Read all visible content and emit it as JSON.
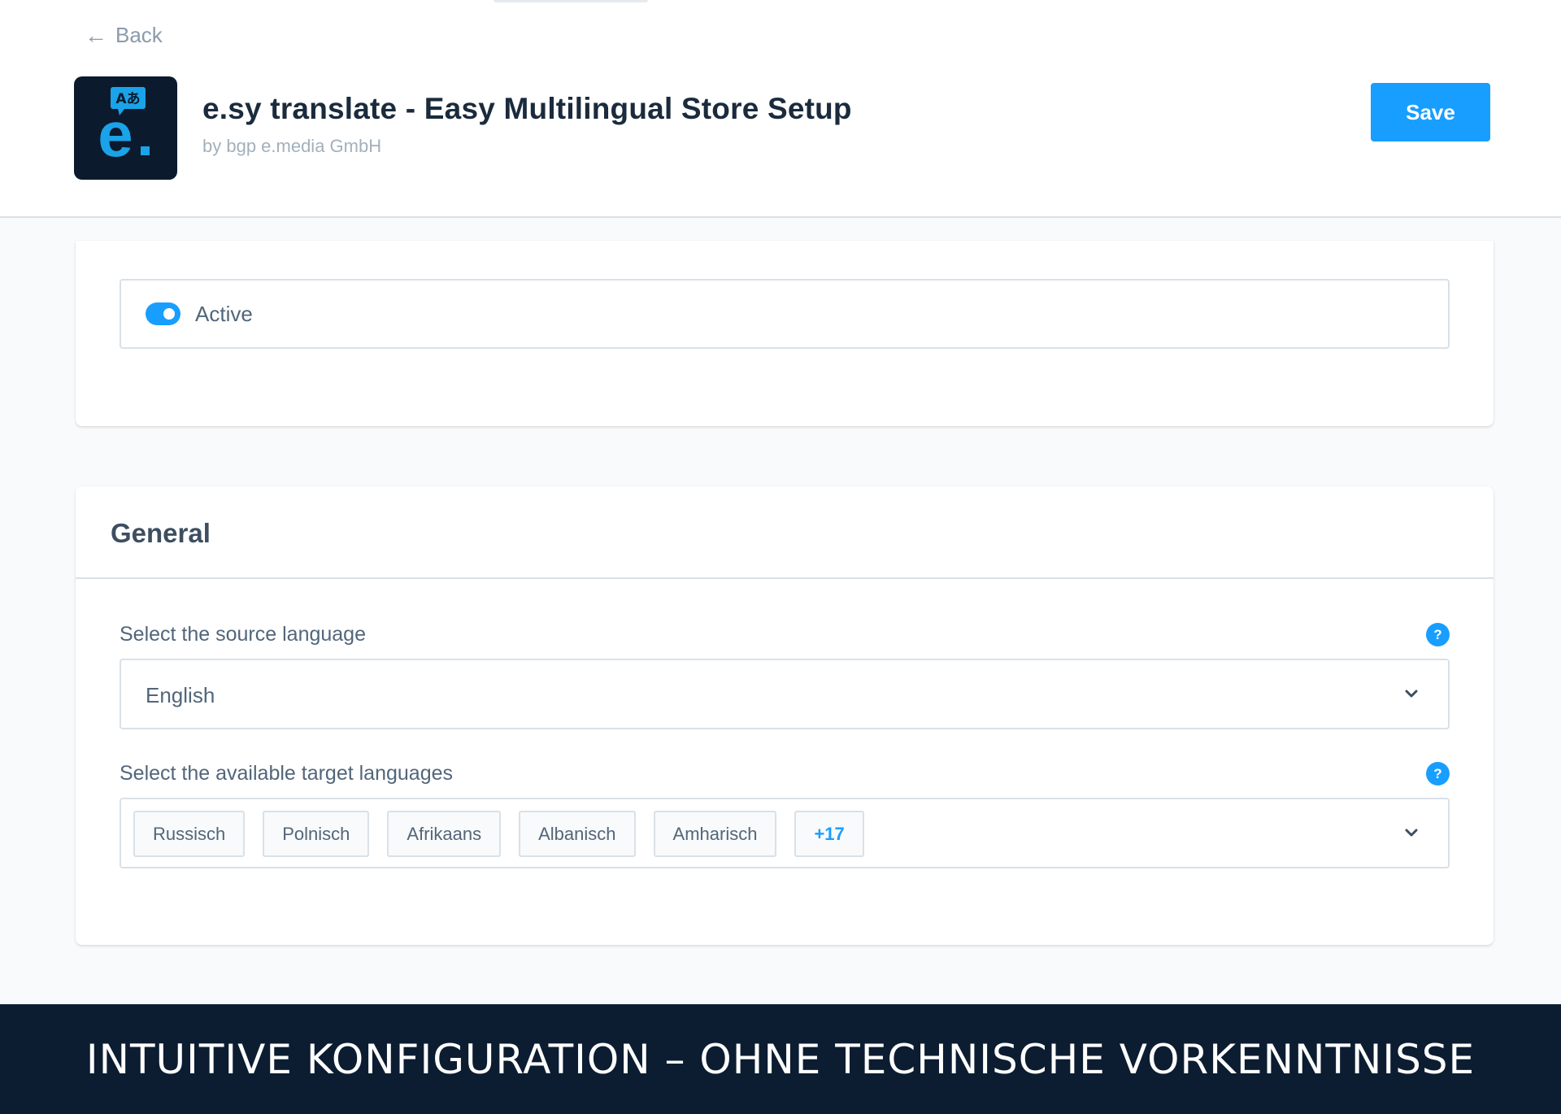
{
  "header": {
    "back_label": "Back",
    "app_title": "e.sy translate - Easy Multilingual Store Setup",
    "app_vendor": "by bgp e.media GmbH",
    "save_label": "Save",
    "logo": {
      "letter": "e",
      "badge": "Aあ",
      "icon": "translate-logo-icon"
    }
  },
  "status": {
    "active_label": "Active",
    "active": true
  },
  "general": {
    "title": "General",
    "source_language": {
      "label": "Select the source language",
      "value": "English"
    },
    "target_languages": {
      "label": "Select the available target languages",
      "tags": [
        "Russisch",
        "Polnisch",
        "Afrikaans",
        "Albanisch",
        "Amharisch"
      ],
      "more": "+17"
    },
    "help_symbol": "?"
  },
  "banner": {
    "text": "INTUITIVE KONFIGURATION – OHNE TECHNISCHE VORKENNTNISSE"
  },
  "colors": {
    "accent": "#189eff",
    "banner_bg": "#0c1d32",
    "logo_bg": "#0b1a2c"
  }
}
